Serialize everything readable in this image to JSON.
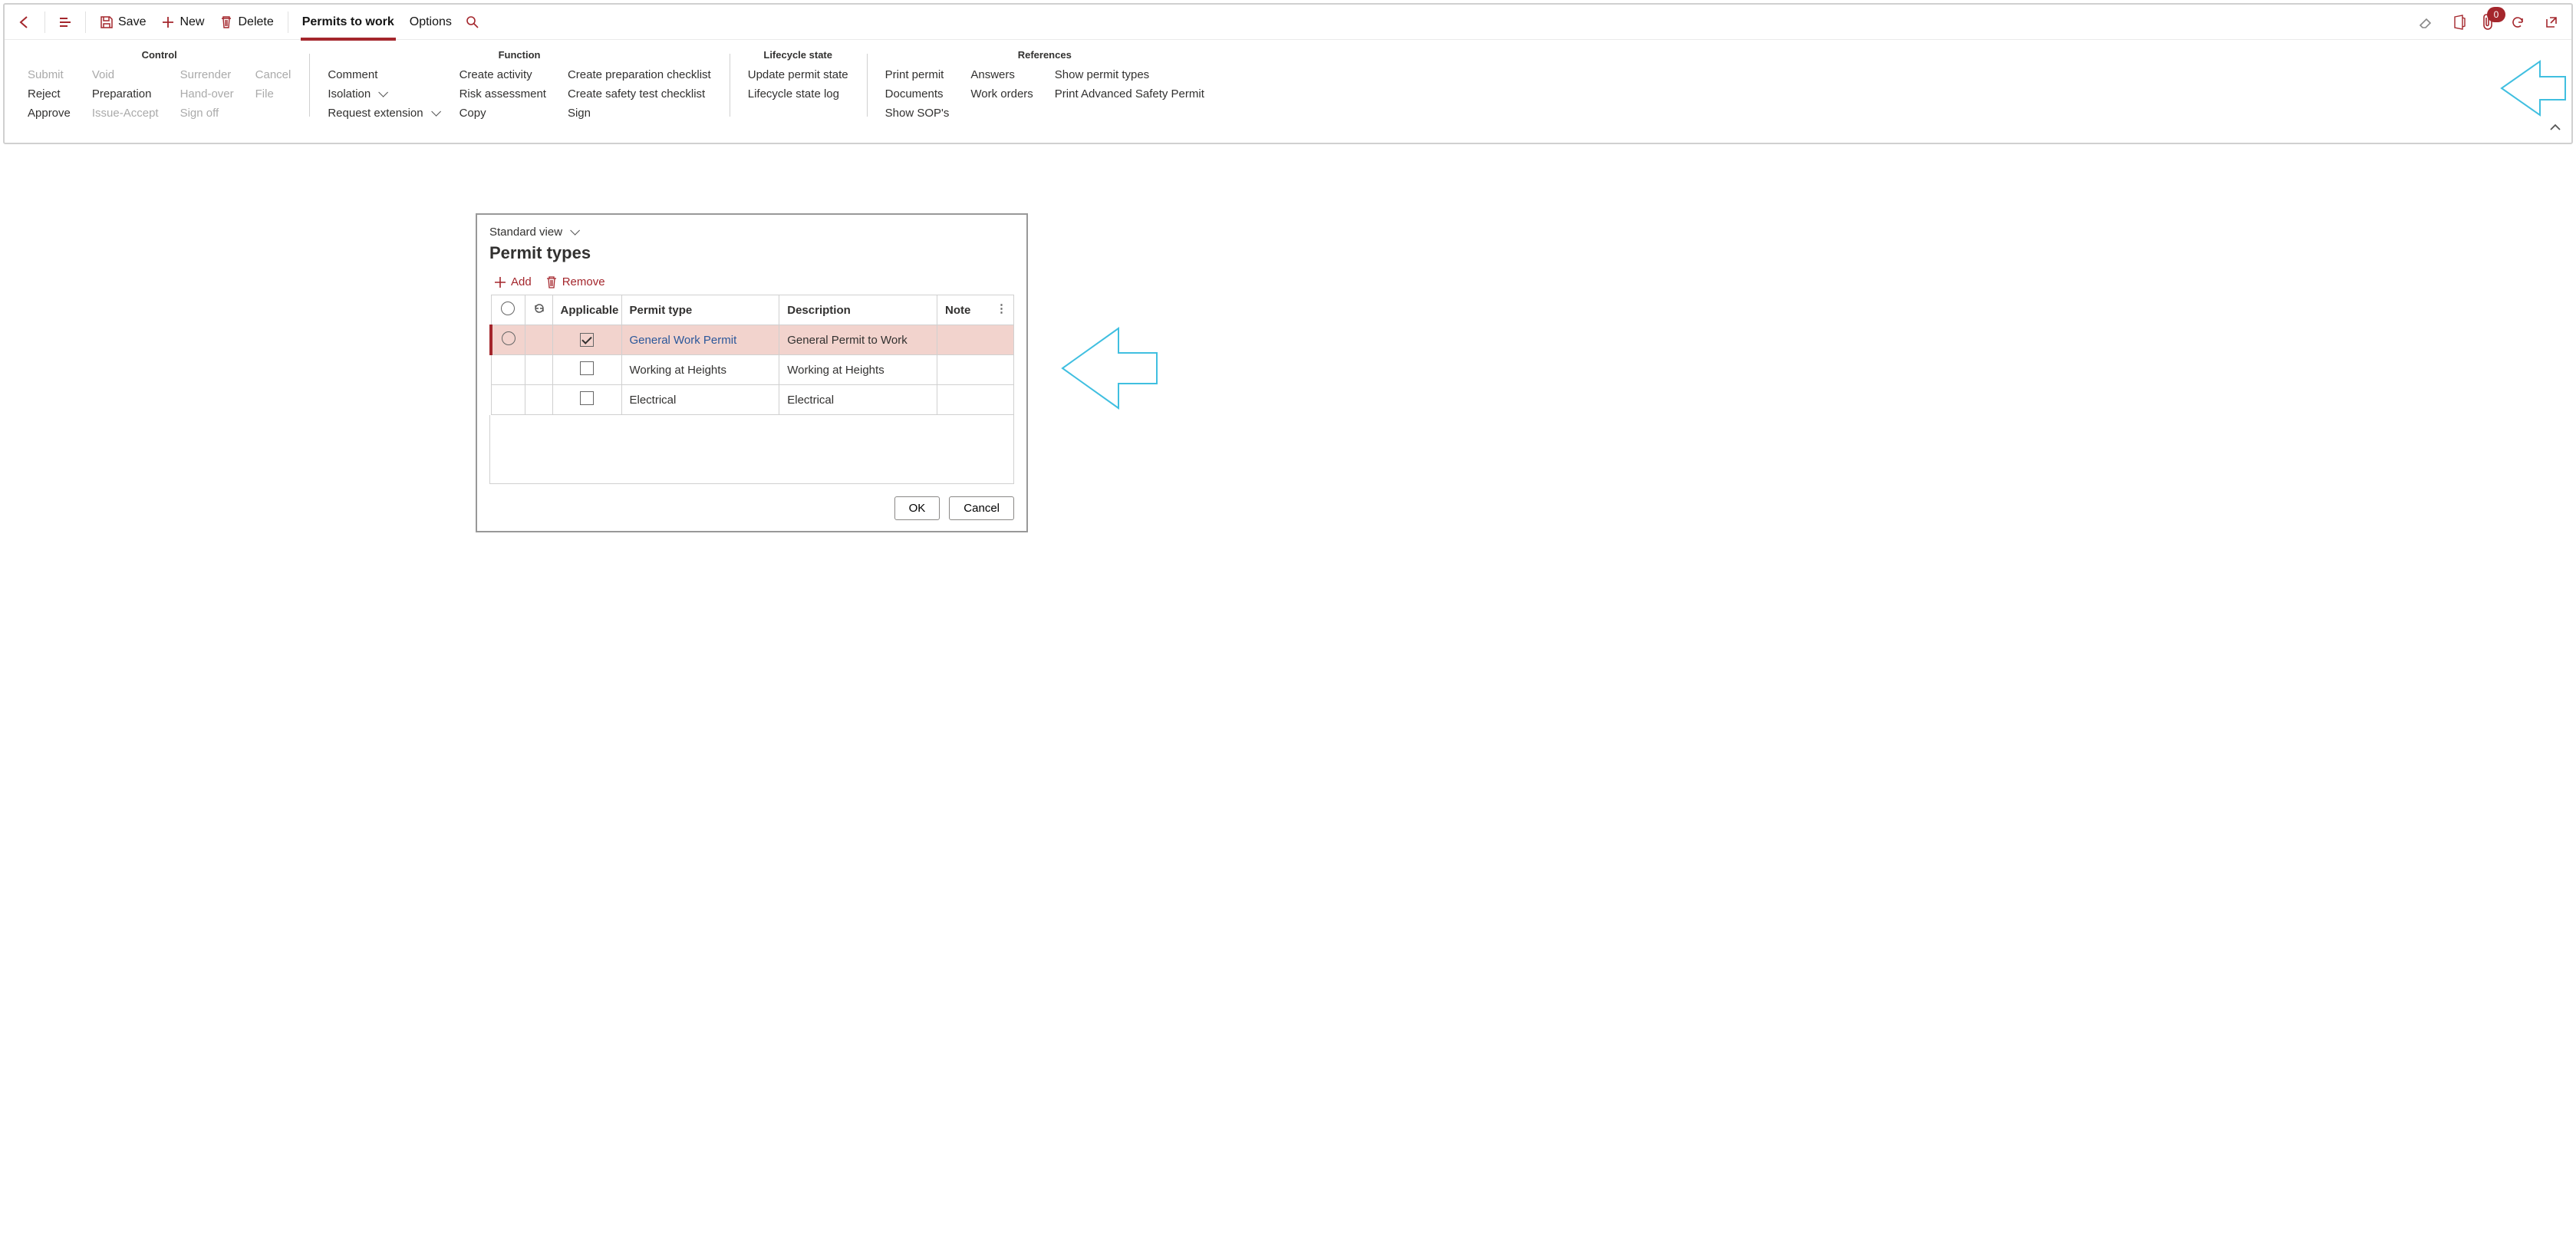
{
  "toolbar": {
    "save": "Save",
    "new": "New",
    "delete": "Delete",
    "tab_active": "Permits to work",
    "tab_options": "Options",
    "attach_count": "0"
  },
  "groups": {
    "control": {
      "title": "Control",
      "items": [
        [
          "Submit",
          "Void",
          "Surrender",
          "Cancel"
        ],
        [
          "Reject",
          "Preparation",
          "Hand-over",
          "File"
        ],
        [
          "Approve",
          "Issue-Accept",
          "Sign off",
          ""
        ]
      ],
      "disabled": [
        "Submit",
        "Void",
        "Surrender",
        "Cancel",
        "Hand-over",
        "File",
        "Issue-Accept",
        "Sign off"
      ]
    },
    "function": {
      "title": "Function",
      "cols": [
        [
          "Comment",
          "Isolation",
          "Request extension"
        ],
        [
          "Create activity",
          "Risk assessment",
          "Copy"
        ],
        [
          "Create preparation checklist",
          "Create safety test checklist",
          "Sign"
        ]
      ],
      "dropdown_items": [
        "Isolation",
        "Request extension"
      ]
    },
    "lifecycle": {
      "title": "Lifecycle state",
      "cols": [
        [
          "Update permit state",
          "Lifecycle state log"
        ]
      ]
    },
    "references": {
      "title": "References",
      "cols": [
        [
          "Print permit",
          "Documents",
          "Show SOP's"
        ],
        [
          "Answers",
          "Work orders"
        ],
        [
          "Show permit types",
          "Print Advanced Safety Permit"
        ]
      ]
    }
  },
  "dialog": {
    "view": "Standard view",
    "title": "Permit types",
    "add": "Add",
    "remove": "Remove",
    "headers": {
      "applicable": "Applicable",
      "permit_type": "Permit type",
      "description": "Description",
      "note": "Note"
    },
    "rows": [
      {
        "selected": true,
        "applicable": true,
        "permit_type": "General Work Permit",
        "description": "General Permit to Work",
        "note": "",
        "link": true
      },
      {
        "selected": false,
        "applicable": false,
        "permit_type": "Working at Heights",
        "description": "Working at Heights",
        "note": "",
        "link": false
      },
      {
        "selected": false,
        "applicable": false,
        "permit_type": "Electrical",
        "description": "Electrical",
        "note": "",
        "link": false
      }
    ],
    "ok": "OK",
    "cancel": "Cancel"
  }
}
